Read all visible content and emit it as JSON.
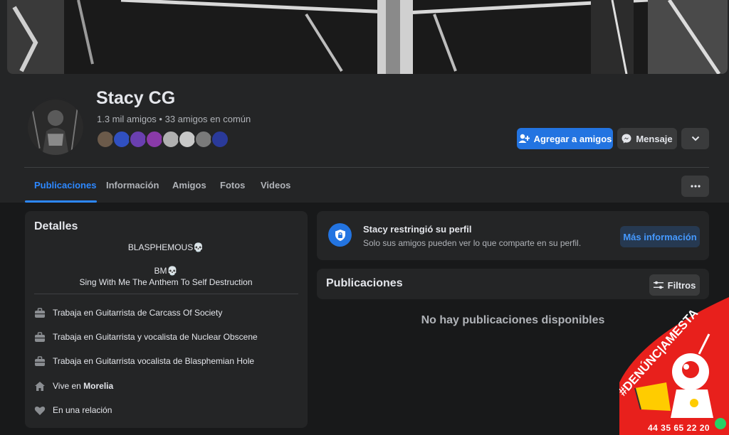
{
  "profile": {
    "name": "Stacy CG",
    "friends_summary": "1.3 mil amigos • 33 amigos en común",
    "mutual_friend_colors": [
      "#6b5a4a",
      "#3050c0",
      "#6a3fb0",
      "#8a3aa8",
      "#b0b0b0",
      "#c8c8c8",
      "#7a7a7a",
      "#2a3a9a"
    ]
  },
  "actions": {
    "add_friend": "Agregar a amigos",
    "message": "Mensaje"
  },
  "tabs": [
    {
      "label": "Publicaciones",
      "active": true
    },
    {
      "label": "Información",
      "active": false
    },
    {
      "label": "Amigos",
      "active": false
    },
    {
      "label": "Fotos",
      "active": false
    },
    {
      "label": "Videos",
      "active": false
    }
  ],
  "details": {
    "title": "Detalles",
    "bio_line1": "BLASPHEMOUS💀",
    "bio_line2": "BM💀",
    "bio_line3": "Sing With Me The Anthem To Self Destruction",
    "items": [
      {
        "icon": "briefcase-icon",
        "text": "Trabaja en Guitarrista de Carcass Of Society"
      },
      {
        "icon": "briefcase-icon",
        "text": "Trabaja en Guitarrista y vocalista de Nuclear Obscene"
      },
      {
        "icon": "briefcase-icon",
        "text": "Trabaja en Guitarrista vocalista de Blasphemian Hole"
      },
      {
        "icon": "home-icon",
        "prefix": "Vive en ",
        "bold": "Morelia"
      },
      {
        "icon": "heart-icon",
        "text": "En una relación"
      }
    ]
  },
  "restriction": {
    "title": "Stacy restringió su perfil",
    "subtitle": "Solo sus amigos pueden ver lo que comparte en su perfil.",
    "more_info": "Más información"
  },
  "posts": {
    "title": "Publicaciones",
    "filters": "Filtros",
    "empty": "No hay publicaciones disponibles"
  },
  "watermark": {
    "text": "#DENÚNC|AMESTA",
    "phone": "44 35 65 22 20"
  },
  "colors": {
    "background": "#18191a",
    "surface": "#242526",
    "button": "#3a3b3c",
    "accent": "#2d88ff",
    "primary_button": "#2374e1",
    "text_primary": "#e4e6eb",
    "text_secondary": "#b0b3b8",
    "watermark_red": "#e8201c"
  }
}
